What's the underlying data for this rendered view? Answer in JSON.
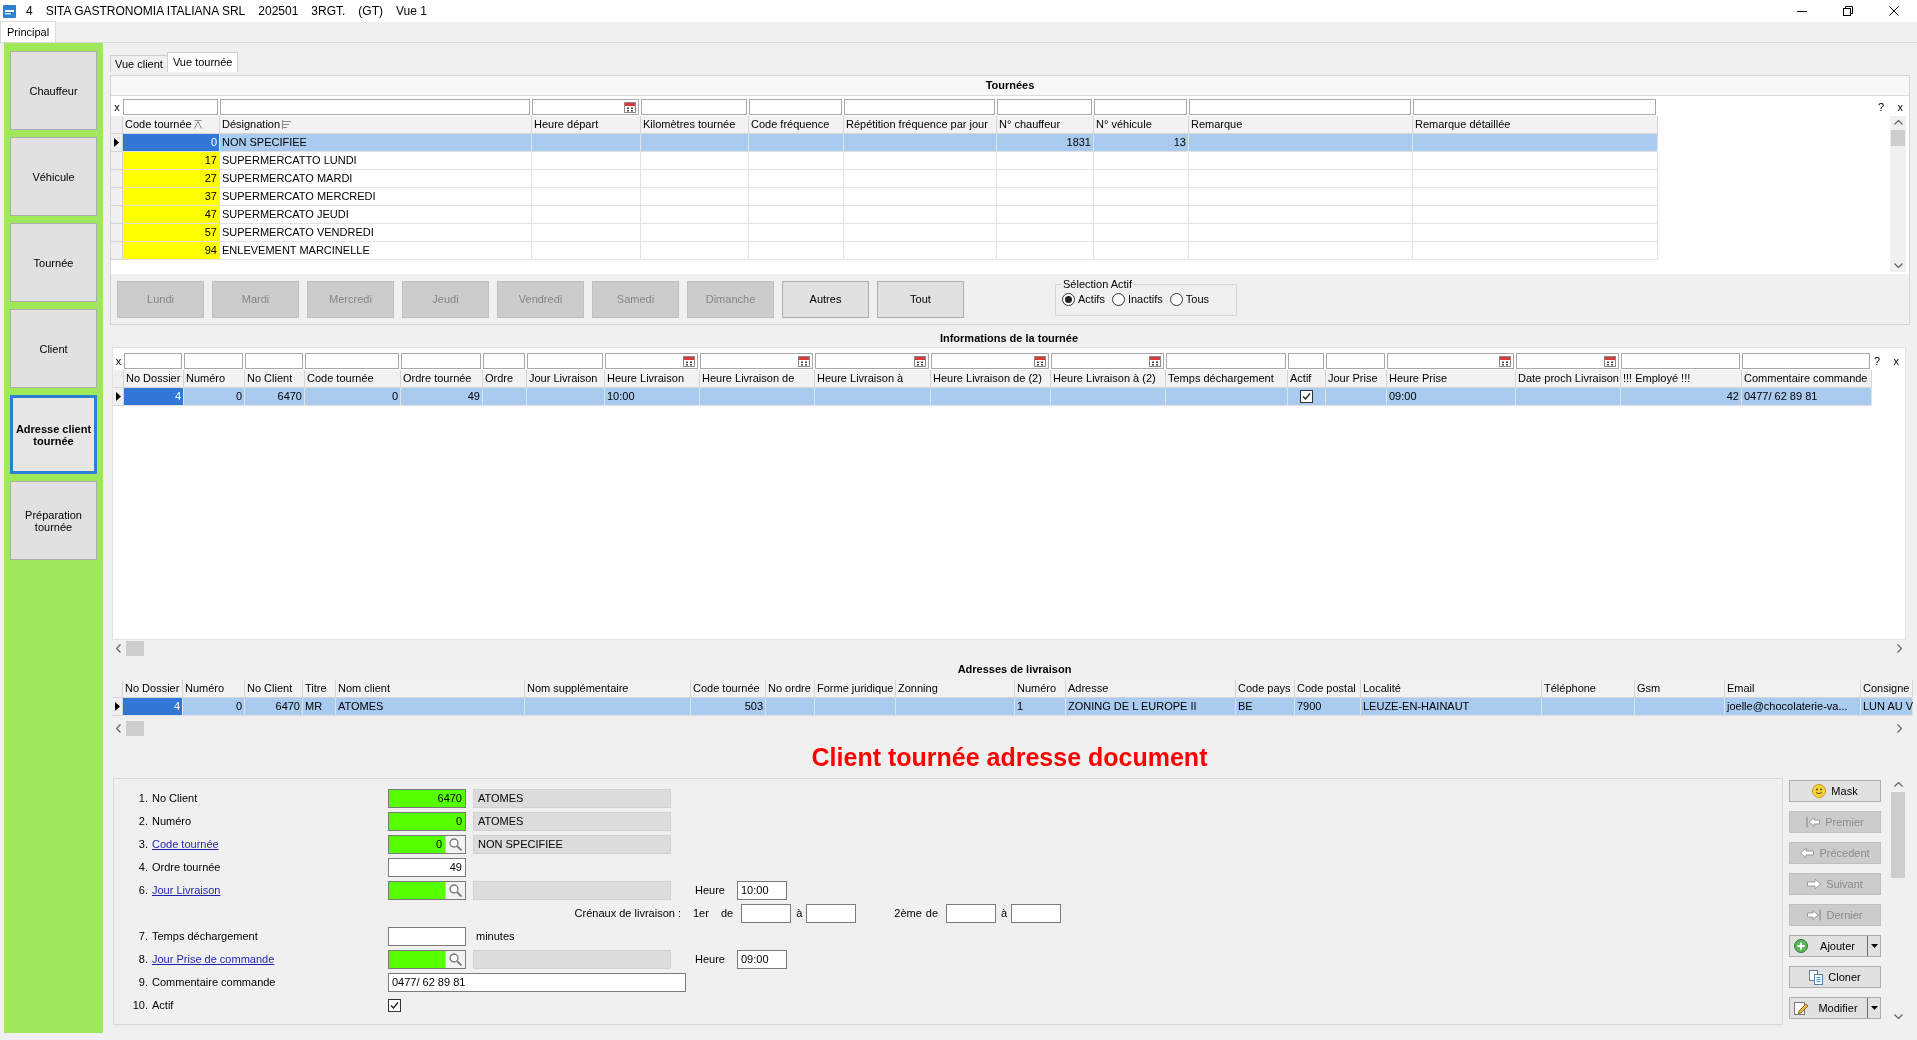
{
  "window": {
    "title_parts": [
      "4",
      "SITA GASTRONOMIA ITALIANA SRL",
      "202501",
      "3RGT.",
      "(GT)",
      "Vue 1"
    ]
  },
  "menu_tabs": [
    {
      "label": "Principal",
      "selected": true
    }
  ],
  "sidebar": {
    "items": [
      {
        "label": "Chauffeur",
        "selected": false
      },
      {
        "label": "Véhicule",
        "selected": false
      },
      {
        "label": "Tournée",
        "selected": false
      },
      {
        "label": "Client",
        "selected": false
      },
      {
        "label": "Adresse client tournée",
        "selected": true
      },
      {
        "label": "Préparation tournée",
        "selected": false
      }
    ]
  },
  "view_tabs": [
    {
      "label": "Vue client",
      "selected": false
    },
    {
      "label": "Vue tournée",
      "selected": true
    }
  ],
  "tournees": {
    "title": "Tournées",
    "filter_clear": "x",
    "help": "?",
    "close": "x",
    "columns": [
      {
        "label": "Code tournée",
        "kind": "number",
        "date_filter": false,
        "sort_indicator": true,
        "group_indicator": false
      },
      {
        "label": "Désignation",
        "kind": "text",
        "date_filter": false,
        "sort_indicator": false,
        "group_indicator": true
      },
      {
        "label": "Heure départ",
        "kind": "text",
        "date_filter": true,
        "sort_indicator": false,
        "group_indicator": false
      },
      {
        "label": "Kilomètres tournée",
        "kind": "number",
        "date_filter": false,
        "sort_indicator": false,
        "group_indicator": false
      },
      {
        "label": "Code fréquence",
        "kind": "text",
        "date_filter": false,
        "sort_indicator": false,
        "group_indicator": false
      },
      {
        "label": "Répétition fréquence par jour",
        "kind": "number",
        "date_filter": false,
        "sort_indicator": false,
        "group_indicator": false
      },
      {
        "label": "N° chauffeur",
        "kind": "number",
        "date_filter": false,
        "sort_indicator": false,
        "group_indicator": false
      },
      {
        "label": "N° véhicule",
        "kind": "number",
        "date_filter": false,
        "sort_indicator": false,
        "group_indicator": false
      },
      {
        "label": "Remarque",
        "kind": "text",
        "date_filter": false,
        "sort_indicator": false,
        "group_indicator": false
      },
      {
        "label": "Remarque détaillée",
        "kind": "text",
        "date_filter": false,
        "sort_indicator": false,
        "group_indicator": false
      }
    ],
    "rows": [
      {
        "selected": true,
        "cells": {
          "code_tournee": "0",
          "designation": "NON SPECIFIEE",
          "n_chauffeur": "1831",
          "n_vehicule": "13"
        }
      },
      {
        "selected": false,
        "color": "#ffff00",
        "cells": {
          "code_tournee": "17",
          "designation": "SUPERMERCATTO LUNDI"
        }
      },
      {
        "selected": false,
        "color": "#ffff00",
        "cells": {
          "code_tournee": "27",
          "designation": "SUPERMERCATO MARDI"
        }
      },
      {
        "selected": false,
        "color": "#ffff00",
        "cells": {
          "code_tournee": "37",
          "designation": "SUPERMERCATO MERCREDI"
        }
      },
      {
        "selected": false,
        "color": "#ffff00",
        "cells": {
          "code_tournee": "47",
          "designation": "SUPERMERCATO JEUDI"
        }
      },
      {
        "selected": false,
        "color": "#ffff00",
        "cells": {
          "code_tournee": "57",
          "designation": "SUPERMERCATO VENDREDI"
        }
      },
      {
        "selected": false,
        "color": "#ffff00",
        "cells": {
          "code_tournee": "94",
          "designation": "ENLEVEMENT MARCINELLE"
        }
      }
    ]
  },
  "filter_buttons": [
    {
      "label": "Lundi",
      "disabled": true
    },
    {
      "label": "Mardi",
      "disabled": true
    },
    {
      "label": "Mercredi",
      "disabled": true
    },
    {
      "label": "Jeudi",
      "disabled": true
    },
    {
      "label": "Vendredi",
      "disabled": true
    },
    {
      "label": "Samedi",
      "disabled": true
    },
    {
      "label": "Dimanche",
      "disabled": true
    },
    {
      "label": "Autres",
      "disabled": false
    },
    {
      "label": "Tout",
      "disabled": false
    }
  ],
  "selection_actif": {
    "title": "Sélection Actif",
    "options": [
      {
        "label": "Actifs",
        "selected": true
      },
      {
        "label": "Inactifs",
        "selected": false
      },
      {
        "label": "Tous",
        "selected": false
      }
    ]
  },
  "informations": {
    "title": "Informations de la tournée",
    "filter_clear": "x",
    "help": "?",
    "close": "x",
    "columns": [
      {
        "label": "No Dossier",
        "kind": "number",
        "date_filter": false
      },
      {
        "label": "Numéro",
        "kind": "number",
        "date_filter": false
      },
      {
        "label": "No Client",
        "kind": "number",
        "date_filter": false
      },
      {
        "label": "Code tournée",
        "kind": "number",
        "date_filter": false
      },
      {
        "label": "Ordre tournée",
        "kind": "number",
        "date_filter": false
      },
      {
        "label": "Ordre",
        "kind": "number",
        "date_filter": false
      },
      {
        "label": "Jour Livraison",
        "kind": "text",
        "date_filter": false
      },
      {
        "label": "Heure Livraison",
        "kind": "text",
        "date_filter": true
      },
      {
        "label": "Heure Livraison de",
        "kind": "text",
        "date_filter": true
      },
      {
        "label": "Heure Livraison à",
        "kind": "text",
        "date_filter": true
      },
      {
        "label": "Heure Livraison de (2)",
        "kind": "text",
        "date_filter": true
      },
      {
        "label": "Heure Livraison à (2)",
        "kind": "text",
        "date_filter": true
      },
      {
        "label": "Temps déchargement",
        "kind": "number",
        "date_filter": false
      },
      {
        "label": "Actif",
        "kind": "check",
        "date_filter": false
      },
      {
        "label": "Jour Prise",
        "kind": "text",
        "date_filter": false
      },
      {
        "label": "Heure Prise",
        "kind": "text",
        "date_filter": true
      },
      {
        "label": "Date proch Livraison",
        "kind": "text",
        "date_filter": true
      },
      {
        "label": "!!! Employé !!!",
        "kind": "number",
        "date_filter": false
      },
      {
        "label": "Commentaire commande",
        "kind": "text",
        "date_filter": false
      }
    ],
    "rows": [
      {
        "selected": true,
        "cells": {
          "no_dossier": "4",
          "numero": "0",
          "no_client": "6470",
          "code_tournee": "0",
          "ordre_tournee": "49",
          "heure_livraison": "10:00",
          "actif": true,
          "heure_prise": "09:00",
          "employe": "42",
          "commentaire_commande": "0477/ 62 89 81"
        }
      }
    ]
  },
  "adresses": {
    "title": "Adresses de livraison",
    "columns": [
      {
        "label": "No Dossier",
        "kind": "number"
      },
      {
        "label": "Numéro",
        "kind": "number"
      },
      {
        "label": "No Client",
        "kind": "number"
      },
      {
        "label": "Titre",
        "kind": "text"
      },
      {
        "label": "Nom client",
        "kind": "text"
      },
      {
        "label": "Nom supplémentaire",
        "kind": "text"
      },
      {
        "label": "Code tournée",
        "kind": "number"
      },
      {
        "label": "No ordre",
        "kind": "number"
      },
      {
        "label": "Forme juridique",
        "kind": "text"
      },
      {
        "label": "Zonning",
        "kind": "text"
      },
      {
        "label": "Numéro",
        "kind": "text"
      },
      {
        "label": "Adresse",
        "kind": "text"
      },
      {
        "label": "Code pays",
        "kind": "text"
      },
      {
        "label": "Code postal",
        "kind": "text"
      },
      {
        "label": "Localité",
        "kind": "text"
      },
      {
        "label": "Téléphone",
        "kind": "text"
      },
      {
        "label": "Gsm",
        "kind": "text"
      },
      {
        "label": "Email",
        "kind": "text"
      },
      {
        "label": "Consigne",
        "kind": "text"
      }
    ],
    "rows": [
      {
        "selected": true,
        "cells": {
          "no_dossier": "4",
          "numero": "0",
          "no_client": "6470",
          "titre": "MR",
          "nom_client": "ATOMES",
          "code_tournee": "503",
          "numero_adresse": "1",
          "adresse": "ZONING DE L EUROPE II",
          "code_pays": "BE",
          "code_postal": "7900",
          "localite": "LEUZE-EN-HAINAUT",
          "email": "joelle@chocolaterie-va...",
          "consigne": "LUN AU V"
        }
      }
    ]
  },
  "form": {
    "title": "Client tournée adresse document",
    "fields": [
      {
        "kind": "lookup",
        "number": "1.",
        "label": "No Client",
        "link": false,
        "highlighted": true,
        "value": "6470",
        "description": "ATOMES",
        "search": false
      },
      {
        "kind": "lookup",
        "number": "2.",
        "label": "Numéro",
        "link": false,
        "highlighted": true,
        "value": "0",
        "description": "ATOMES",
        "search": false
      },
      {
        "kind": "lookup",
        "number": "3.",
        "label": "Code tournée",
        "link": true,
        "highlighted": true,
        "value": "0",
        "description": "NON SPECIFIEE",
        "search": true
      },
      {
        "kind": "number",
        "number": "4.",
        "label": "Ordre tournée",
        "link": false,
        "highlighted": false,
        "value": "49"
      },
      {
        "kind": "lookup",
        "number": "6.",
        "label": "Jour Livraison",
        "link": true,
        "highlighted": true,
        "search": true,
        "time": {
          "label": "Heure",
          "value": "10:00"
        }
      },
      {
        "kind": "slots",
        "label": "Crénaux de livraison :",
        "slots": [
          {
            "label": "1er",
            "from_label": "de",
            "to_label": "à"
          },
          {
            "label": "2ème",
            "from_label": "de",
            "to_label": "à"
          }
        ]
      },
      {
        "kind": "number",
        "number": "7.",
        "label": "Temps déchargement",
        "link": false,
        "highlighted": false,
        "unit": "minutes"
      },
      {
        "kind": "lookup",
        "number": "8.",
        "label": "Jour Prise de commande",
        "link": true,
        "highlighted": true,
        "search": true,
        "time": {
          "label": "Heure",
          "value": "09:00"
        }
      },
      {
        "kind": "text",
        "number": "9.",
        "label": "Commentaire commande",
        "link": false,
        "highlighted": false,
        "value": "0477/ 62 89 81"
      },
      {
        "kind": "check",
        "number": "10.",
        "label": "Actif",
        "link": false,
        "checked": true
      }
    ]
  },
  "action_buttons": [
    {
      "kind": "mask",
      "label": "Mask",
      "disabled": false,
      "dropdown": false
    },
    {
      "kind": "first",
      "label": "Premier",
      "disabled": true,
      "dropdown": false
    },
    {
      "kind": "previous",
      "label": "Précedent",
      "disabled": true,
      "dropdown": false
    },
    {
      "kind": "next",
      "label": "Suivant",
      "disabled": true,
      "dropdown": false
    },
    {
      "kind": "last",
      "label": "Dernier",
      "disabled": true,
      "dropdown": false
    },
    {
      "kind": "add",
      "label": "Ajouter",
      "disabled": false,
      "dropdown": true
    },
    {
      "kind": "clone",
      "label": "Cloner",
      "disabled": false,
      "dropdown": false
    },
    {
      "kind": "edit",
      "label": "Modifier",
      "disabled": false,
      "dropdown": true
    }
  ]
}
